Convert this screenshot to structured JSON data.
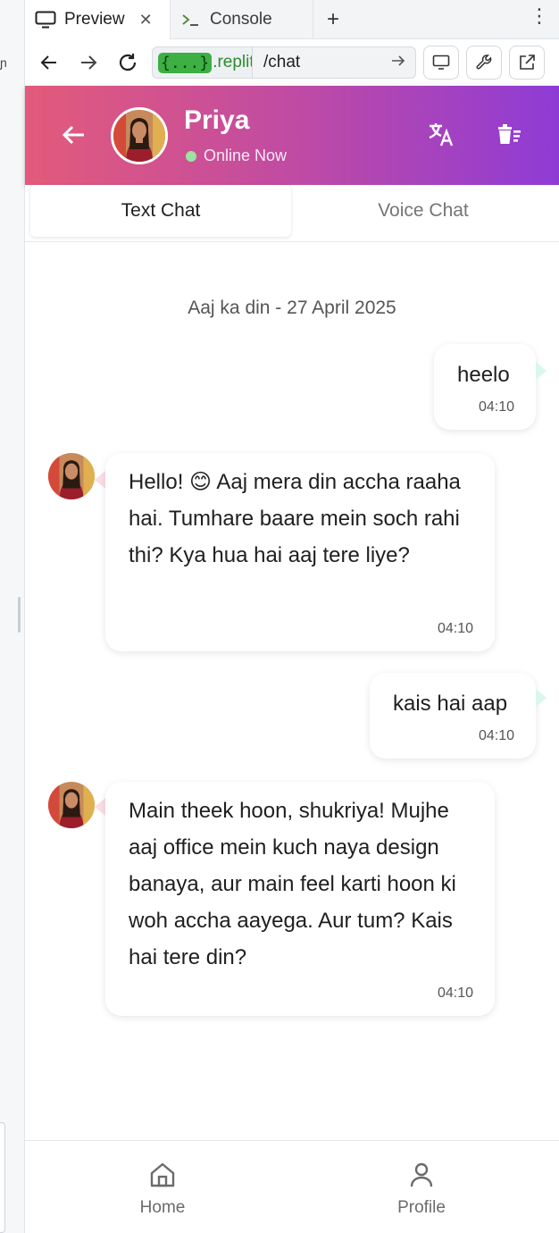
{
  "browser": {
    "tabs": [
      {
        "label": "Preview",
        "icon": "monitor-icon"
      },
      {
        "label": "Console",
        "icon": "terminal-icon"
      }
    ],
    "new_tab_symbol": "+",
    "menu_symbol": "⋮",
    "address": {
      "braces": "{...}",
      "domain": ".replit.c",
      "path": "/chat"
    }
  },
  "chat": {
    "contact": {
      "name": "Priya",
      "status": "Online Now",
      "status_color": "#9be3a0"
    },
    "modes": [
      "Text Chat",
      "Voice Chat"
    ],
    "date_separator": "Aaj ka din - 27 April 2025",
    "messages": [
      {
        "from": "user",
        "text": "heelo",
        "time": "04:10"
      },
      {
        "from": "contact",
        "text": "Hello! 😊 Aaj mera din accha raaha hai. Tumhare baare mein soch rahi thi? Kya hua hai aaj tere liye?",
        "time": "04:10"
      },
      {
        "from": "user",
        "text": "kais hai aap",
        "time": "04:10"
      },
      {
        "from": "contact",
        "text": "Main theek hoon, shukriya! Mujhe aaj office mein kuch naya design banaya, aur main feel karti hoon ki woh accha aayega. Aur tum? Kais hai tere din?",
        "time": "04:10"
      }
    ]
  },
  "nav": {
    "items": [
      {
        "label": "Home",
        "icon": "home-icon"
      },
      {
        "label": "Profile",
        "icon": "user-icon"
      }
    ]
  },
  "colors": {
    "header_gradient": [
      "#e35a7a",
      "#c04ba3",
      "#8e3bd6"
    ]
  }
}
